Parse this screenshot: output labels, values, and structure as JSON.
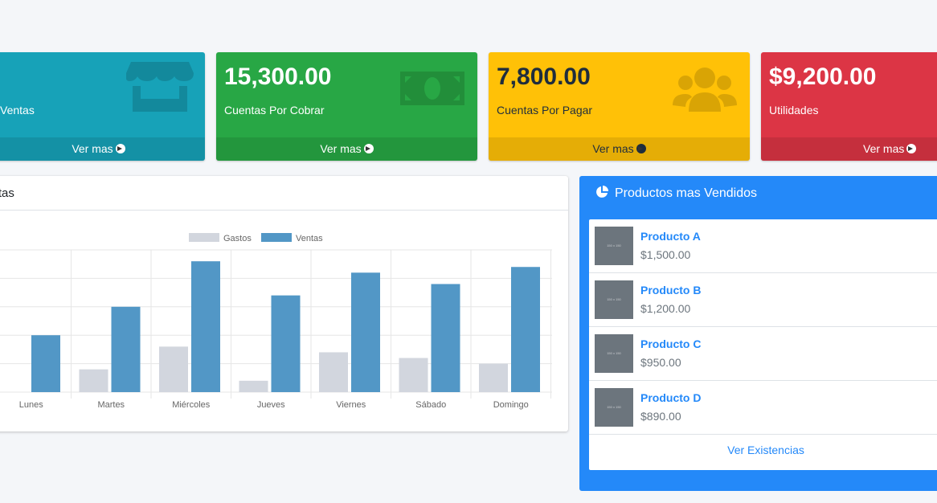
{
  "boxes": [
    {
      "value": "",
      "label": "Ventas",
      "footer": "Ver mas",
      "icon": "store-icon",
      "color": "#17a2b8"
    },
    {
      "value": "15,300.00",
      "label": "Cuentas Por Cobrar",
      "footer": "Ver mas",
      "icon": "money-icon",
      "color": "#28a745"
    },
    {
      "value": "7,800.00",
      "label": "Cuentas Por Pagar",
      "footer": "Ver mas",
      "icon": "users-icon",
      "color": "#ffc107"
    },
    {
      "value": "$9,200.00",
      "label": "Utilidades",
      "footer": "Ver mas",
      "icon": "arrow-circle-right-icon",
      "color": "#dc3545"
    }
  ],
  "chart_card": {
    "title": "Ventas"
  },
  "chart_data": {
    "type": "bar",
    "categories": [
      "Lunes",
      "Martes",
      "Miércoles",
      "Jueves",
      "Viernes",
      "Sábado",
      "Domingo"
    ],
    "series": [
      {
        "name": "Gastos",
        "color": "#d2d6de",
        "values": [
          0,
          400,
          800,
          200,
          700,
          600,
          500
        ]
      },
      {
        "name": "Ventas",
        "color": "#5297c6",
        "values": [
          1000,
          1500,
          2300,
          1700,
          2100,
          1900,
          2200
        ]
      }
    ],
    "ylim": [
      0,
      2500
    ],
    "grid": true,
    "legend": "top"
  },
  "products": {
    "title": "Productos mas Vendidos",
    "thumb_text": "150 x 150",
    "items": [
      {
        "name": "Producto A",
        "price": "$1,500.00"
      },
      {
        "name": "Producto B",
        "price": "$1,200.00"
      },
      {
        "name": "Producto C",
        "price": "$950.00"
      },
      {
        "name": "Producto D",
        "price": "$890.00"
      }
    ],
    "footer": "Ver Existencias"
  }
}
